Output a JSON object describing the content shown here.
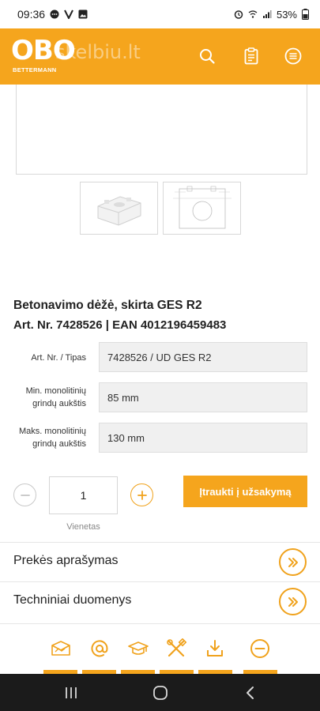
{
  "status_bar": {
    "time": "09:36",
    "battery": "53%"
  },
  "header": {
    "logo_text": "OBO",
    "logo_subtext": "BETTERMANN",
    "watermark": "skelbiu.lt",
    "icons": [
      "search-icon",
      "clipboard-icon",
      "menu-icon"
    ],
    "accent_color": "#f5a51d"
  },
  "product": {
    "title": "Betonavimo dėžė, skirta GES R2",
    "ids": "Art. Nr. 7428526 | EAN 4012196459483",
    "specs": [
      {
        "label": "Art. Nr. / Tipas",
        "value": "7428526 / UD GES R2"
      },
      {
        "label": "Min. monolitinių grindų aukštis",
        "value": "85 mm"
      },
      {
        "label": "Maks. monolitinių grindų aukštis",
        "value": "130 mm"
      }
    ]
  },
  "order": {
    "quantity": "1",
    "unit": "Vienetas",
    "button_label": "Įtraukti į užsakymą"
  },
  "sections": [
    {
      "label": "Prekės aprašymas"
    },
    {
      "label": "Techniniai duomenys"
    }
  ],
  "toolbar": {
    "icons": [
      "handshake-mail-icon",
      "at-sign-icon",
      "graduation-cap-icon",
      "tools-icon",
      "download-icon",
      "minus-circle-icon"
    ]
  },
  "nav": {
    "icons": [
      "recent-apps-icon",
      "home-icon",
      "back-icon"
    ]
  }
}
